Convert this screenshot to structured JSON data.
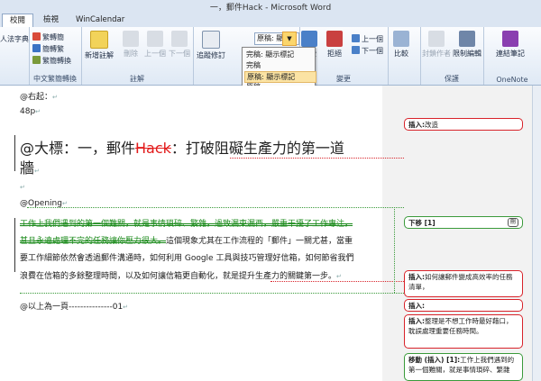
{
  "window": {
    "title": "一，郵件Hack - Microsoft Word"
  },
  "tabs": [
    {
      "label": "校閱"
    },
    {
      "label": "檢視"
    },
    {
      "label": "WinCalendar"
    }
  ],
  "ribbon": {
    "left_partial": "人法字典",
    "chinese_group": {
      "label": "中文繁簡轉換",
      "items": [
        "繁轉簡",
        "簡轉繁",
        "繁簡轉換"
      ]
    },
    "comments_group": {
      "label": "註解",
      "new": "新增註解",
      "delete": "刪除",
      "prev": "上一個",
      "next": "下一個"
    },
    "tracking_group": {
      "track": "追蹤修訂",
      "display_value": "原稿: 顯示...",
      "dropdown_items": [
        "完稿: 顯示標記",
        "完稿",
        "原稿: 顯示標記",
        "原稿"
      ],
      "selected_index": 2
    },
    "changes_group": {
      "label": "變更",
      "accept": "接受",
      "reject": "拒絕",
      "prev": "上一個",
      "next": "下一個"
    },
    "compare_group": {
      "compare": "比較"
    },
    "protect_group": {
      "label": "保護",
      "block_authors": "封鎖作者",
      "restrict": "限制編輯"
    },
    "onenote_group": {
      "label": "OneNote",
      "linked": "連結筆記"
    }
  },
  "doc": {
    "l1": "@右起：",
    "l2": "48p",
    "heading_a": "@大標：一，郵件",
    "heading_del": "Hack",
    "heading_b": "：打破阻礙生產力的第一道",
    "heading_c": "牆",
    "opening": "@Opening",
    "moved1": "工作上我們遇到的第一個難關，就是事情瑣碎、繁雜，過致漏東漏西，嚴重干擾了工作專注，",
    "moved2": "甚且永遠處理不完的任務讓你壓力很大。",
    "p1_rest": "這個現象尤其在工作流程的「郵件」一關尤甚，當重",
    "p2": "要工作細節依然會透過郵件溝通時，如何利用 Google 工具與技巧管理好信箱，如何節省我們",
    "p3": "浪費在信箱的多餘整理時間，以及如何讓信箱更自動化，就是提升生產力的關鍵第一步。",
    "end": "@以上為一頁---------------01"
  },
  "balloons": [
    {
      "prefix": "插入:",
      "text": "改造"
    },
    {
      "prefix": "下移 [1]",
      "text": "",
      "badge": "刪"
    },
    {
      "prefix": "插入:",
      "text": "如何讓郵件變成高效率的任務清單，"
    },
    {
      "prefix": "插入:",
      "text": ""
    },
    {
      "prefix": "插入:",
      "text": "整理是不想工作時最好藉口，耽誤處理重要任務時間。"
    },
    {
      "prefix": "移動 (插入) [1]:",
      "text": "工作上我們遇到的第一個難關，就是事情瑣碎、繁雜"
    }
  ]
}
